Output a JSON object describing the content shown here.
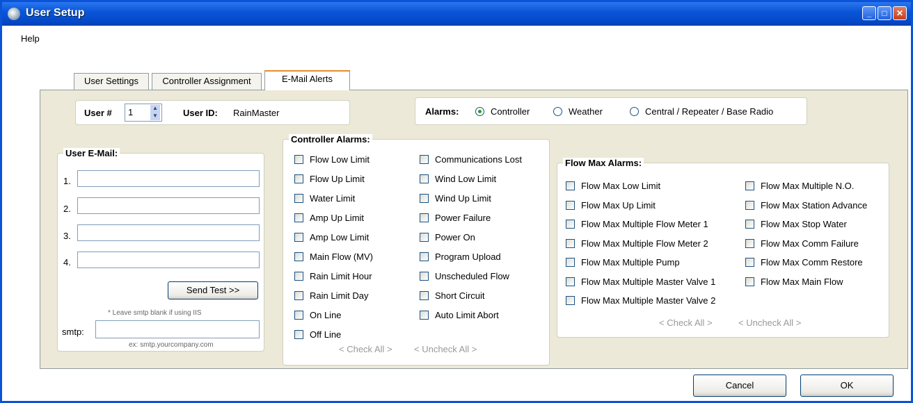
{
  "window": {
    "title": "User Setup"
  },
  "menu": {
    "help": "Help"
  },
  "tabs": [
    "User Settings",
    "Controller Assignment",
    "E-Mail Alerts"
  ],
  "user": {
    "number_label": "User #",
    "number_value": "1",
    "id_label": "User ID:",
    "id_value": "RainMaster"
  },
  "alarms": {
    "label": "Alarms:",
    "options": [
      "Controller",
      "Weather",
      "Central / Repeater / Base Radio"
    ],
    "selected": "Controller"
  },
  "email": {
    "title": "User E-Mail:",
    "rows": [
      "1.",
      "2.",
      "3.",
      "4."
    ],
    "send_test": "Send Test >>",
    "note": "* Leave smtp blank if using IIS",
    "smtp_label": "smtp:",
    "smtp_example": "ex: smtp.yourcompany.com"
  },
  "controller_alarms": {
    "title": "Controller Alarms:",
    "col1": [
      "Flow Low Limit",
      "Flow Up Limit",
      "Water Limit",
      "Amp Up Limit",
      "Amp Low Limit",
      "Main Flow (MV)",
      "Rain Limit Hour",
      "Rain Limit Day",
      "On Line",
      "Off Line"
    ],
    "col2": [
      "Communications Lost",
      "Wind Low Limit",
      "Wind Up Limit",
      "Power Failure",
      "Power On",
      "Program Upload",
      "Unscheduled Flow",
      "Short Circuit",
      "Auto Limit Abort"
    ],
    "check_all": "< Check All >",
    "uncheck_all": "< Uncheck All >"
  },
  "flow_max_alarms": {
    "title": "Flow Max Alarms:",
    "col1": [
      "Flow Max Low Limit",
      "Flow Max Up Limit",
      "Flow Max Multiple Flow Meter 1",
      "Flow Max Multiple Flow Meter 2",
      "Flow Max Multiple Pump",
      "Flow Max Multiple Master Valve 1",
      "Flow Max Multiple Master Valve 2"
    ],
    "col2": [
      "Flow Max Multiple N.O.",
      "Flow Max Station Advance",
      "Flow Max Stop Water",
      "Flow Max Comm Failure",
      "Flow Max Comm Restore",
      "Flow Max Main Flow"
    ],
    "check_all": "< Check All >",
    "uncheck_all": "< Uncheck All >"
  },
  "buttons": {
    "cancel": "Cancel",
    "ok": "OK"
  }
}
